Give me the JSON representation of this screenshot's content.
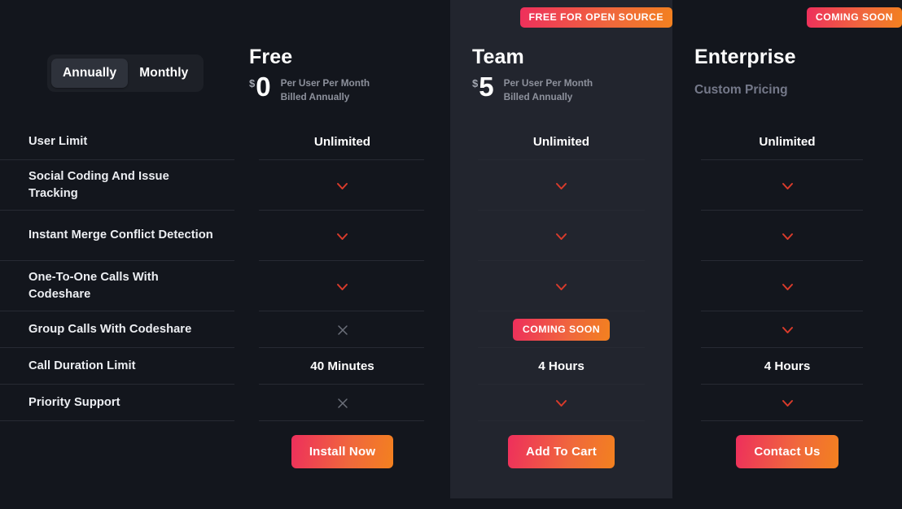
{
  "theme": {
    "page_bg": "#13161d",
    "highlight_panel_bg": "#22252e",
    "accent_gradient_start": "#ee2f5c",
    "accent_gradient_end": "#f3811f",
    "check_color": "#d93b2b",
    "cross_color": "#6c707b",
    "divider_color": "#272a33",
    "muted_text": "#8d919c"
  },
  "billing_toggle": {
    "name": "billing-period-toggle",
    "options": [
      {
        "label": "Annually",
        "active": true
      },
      {
        "label": "Monthly",
        "active": false
      }
    ]
  },
  "features": [
    {
      "label": "User Limit"
    },
    {
      "label": "Social Coding And Issue Tracking"
    },
    {
      "label": "Instant Merge Conflict Detection"
    },
    {
      "label": "One-To-One Calls With Codeshare"
    },
    {
      "label": "Group Calls With Codeshare"
    },
    {
      "label": "Call Duration Limit"
    },
    {
      "label": "Priority Support"
    }
  ],
  "plans": {
    "free": {
      "name": "Free",
      "ribbon": null,
      "currency": "$",
      "amount": "0",
      "per_user": "Per User Per Month",
      "billed": "Billed Annually",
      "cells": [
        {
          "type": "text",
          "value": "Unlimited"
        },
        {
          "type": "check",
          "value": "check-icon"
        },
        {
          "type": "check",
          "value": "check-icon"
        },
        {
          "type": "check",
          "value": "check-icon"
        },
        {
          "type": "cross",
          "value": "cross-icon"
        },
        {
          "type": "text",
          "value": "40 Minutes"
        },
        {
          "type": "cross",
          "value": "cross-icon"
        }
      ],
      "cta_label": "Install Now"
    },
    "team": {
      "name": "Team",
      "ribbon": "FREE FOR OPEN SOURCE",
      "currency": "$",
      "amount": "5",
      "per_user": "Per User Per Month",
      "billed": "Billed Annually",
      "cells": [
        {
          "type": "text",
          "value": "Unlimited"
        },
        {
          "type": "check",
          "value": "check-icon"
        },
        {
          "type": "check",
          "value": "check-icon"
        },
        {
          "type": "check",
          "value": "check-icon"
        },
        {
          "type": "badge",
          "value": "COMING SOON"
        },
        {
          "type": "text",
          "value": "4 Hours"
        },
        {
          "type": "check",
          "value": "check-icon"
        }
      ],
      "cta_label": "Add To Cart"
    },
    "enterprise": {
      "name": "Enterprise",
      "ribbon": "COMING SOON",
      "custom_pricing": "Custom Pricing",
      "cells": [
        {
          "type": "text",
          "value": "Unlimited"
        },
        {
          "type": "check",
          "value": "check-icon"
        },
        {
          "type": "check",
          "value": "check-icon"
        },
        {
          "type": "check",
          "value": "check-icon"
        },
        {
          "type": "check",
          "value": "check-icon"
        },
        {
          "type": "text",
          "value": "4 Hours"
        },
        {
          "type": "check",
          "value": "check-icon"
        }
      ],
      "cta_label": "Contact Us"
    }
  }
}
